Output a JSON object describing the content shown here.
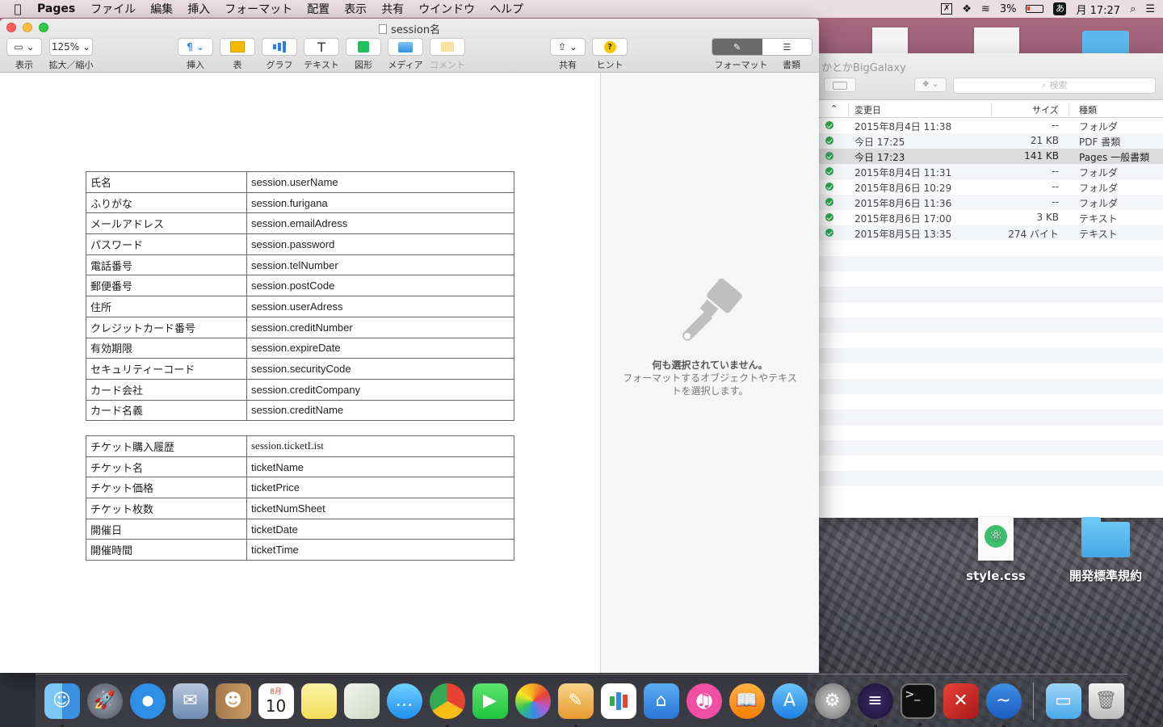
{
  "menubar": {
    "apple": "",
    "app_name": "Pages",
    "items": [
      "ファイル",
      "編集",
      "挿入",
      "フォーマット",
      "配置",
      "表示",
      "共有",
      "ウインドウ",
      "ヘルプ"
    ],
    "battery": "3%",
    "ime": "あ",
    "clock": "月 17:27"
  },
  "pages": {
    "title": "session名",
    "toolbar": {
      "view": "表示",
      "zoom_value": "125%",
      "zoom": "拡大／縮小",
      "insert": "挿入",
      "table": "表",
      "chart": "グラフ",
      "text": "テキスト",
      "shape": "図形",
      "media": "メディア",
      "comment": "コメント",
      "share": "共有",
      "tips": "ヒント",
      "format": "フォーマット",
      "document": "書類"
    },
    "inspector": {
      "title": "何も選択されていません。",
      "body": "フォーマットするオブジェクトやテキストを選択します。"
    },
    "table1": [
      {
        "key": "氏名",
        "value": "session.userName"
      },
      {
        "key": "ふりがな",
        "value": "session.furigana"
      },
      {
        "key": "メールアドレス",
        "value": "session.emailAdress"
      },
      {
        "key": "パスワード",
        "value": "session.password"
      },
      {
        "key": "電話番号",
        "value": "session.telNumber"
      },
      {
        "key": "郵便番号",
        "value": "session.postCode"
      },
      {
        "key": "住所",
        "value": "session.userAdress"
      },
      {
        "key": "クレジットカード番号",
        "value": "session.creditNumber"
      },
      {
        "key": "有効期限",
        "value": "session.expireDate"
      },
      {
        "key": "セキュリティーコード",
        "value": "session.securityCode"
      },
      {
        "key": "カード会社",
        "value": "session.creditCompany"
      },
      {
        "key": "カード名義",
        "value": "session.creditName"
      }
    ],
    "table2": [
      {
        "key": "チケット購入履歴",
        "value": "session.ticketList"
      },
      {
        "key": "チケット名",
        "value": "ticketName"
      },
      {
        "key": "チケット価格",
        "value": "ticketPrice"
      },
      {
        "key": "チケット枚数",
        "value": "ticketNumSheet"
      },
      {
        "key": "開催日",
        "value": "ticketDate"
      },
      {
        "key": "開催時間",
        "value": "ticketTime"
      }
    ]
  },
  "finder": {
    "title": "かとかBigGalaxy",
    "search_placeholder": "検索",
    "columns": {
      "date": "変更日",
      "size": "サイズ",
      "kind": "種類"
    },
    "rows": [
      {
        "date": "2015年8月4日 11:38",
        "size": "--",
        "kind": "フォルダ"
      },
      {
        "date": "今日 17:25",
        "size": "21 KB",
        "kind": "PDF 書類"
      },
      {
        "date": "今日 17:23",
        "size": "141 KB",
        "kind": "Pages 一般書類"
      },
      {
        "date": "2015年8月4日 11:31",
        "size": "--",
        "kind": "フォルダ"
      },
      {
        "date": "2015年8月6日 10:29",
        "size": "--",
        "kind": "フォルダ"
      },
      {
        "date": "2015年8月6日 11:36",
        "size": "--",
        "kind": "フォルダ"
      },
      {
        "date": "2015年8月6日 17:00",
        "size": "3 KB",
        "kind": "テキスト"
      },
      {
        "date": "2015年8月5日 13:35",
        "size": "274 バイト",
        "kind": "テキスト"
      }
    ]
  },
  "desktop": {
    "icons": [
      "style.css",
      "開発標準規約"
    ]
  },
  "dock": {
    "calendar_month": "8月",
    "calendar_day": "10"
  }
}
